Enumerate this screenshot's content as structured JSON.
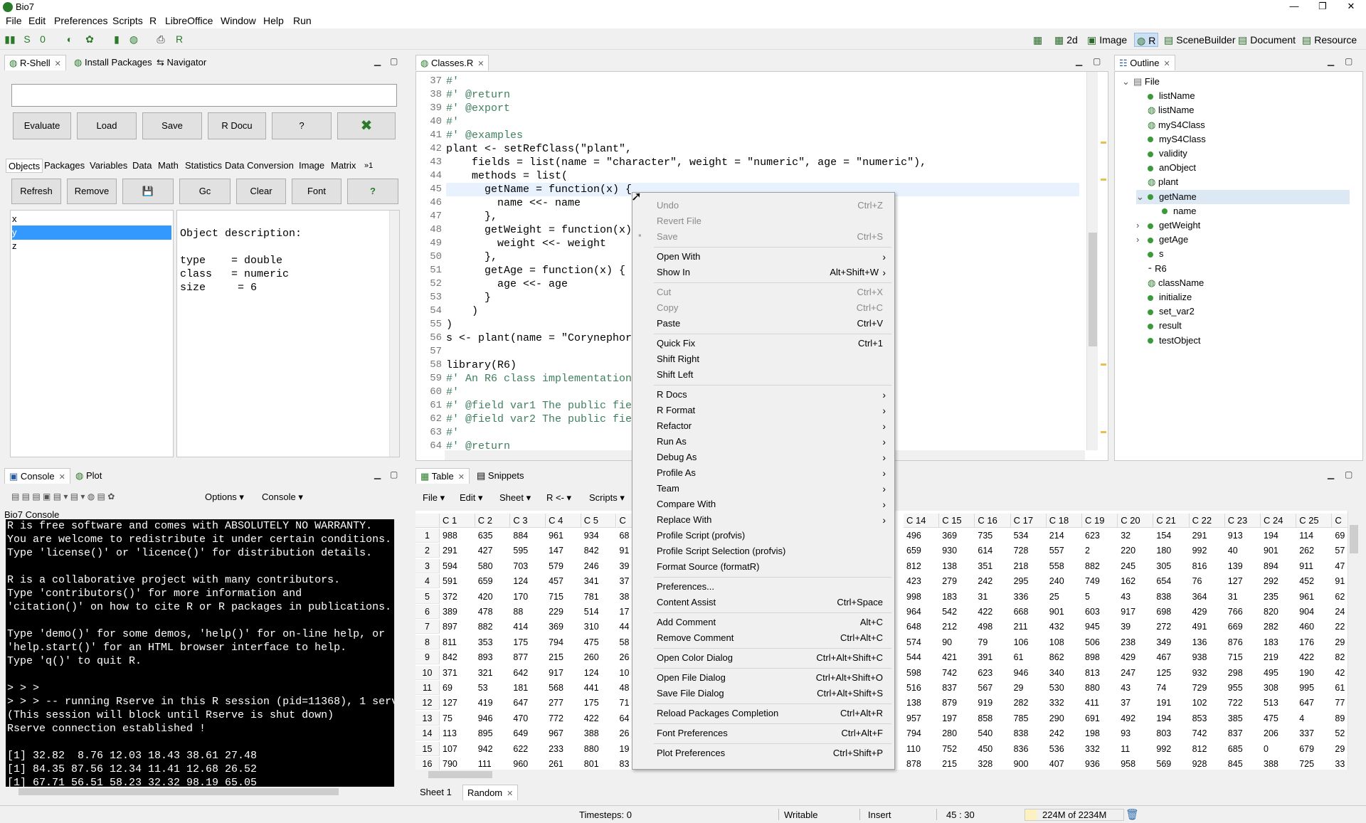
{
  "window": {
    "title": "Bio7",
    "minimize": "—",
    "restore": "❐",
    "close": "✕"
  },
  "menu": [
    "File",
    "Edit",
    "Preferences",
    "Scripts",
    "R",
    "LibreOffice",
    "Window",
    "Help",
    "Run"
  ],
  "perspectives": [
    {
      "label": "2d"
    },
    {
      "label": "Image"
    },
    {
      "label": "R"
    },
    {
      "label": "SceneBuilder"
    },
    {
      "label": "Document"
    },
    {
      "label": "Resource"
    }
  ],
  "rshell": {
    "tabs": [
      "R-Shell",
      "Install Packages",
      "Navigator"
    ],
    "input_value": "",
    "buttons": [
      "Evaluate",
      "Load",
      "Save",
      "R Docu",
      "?",
      "✖"
    ],
    "subtabs": [
      "Objects",
      "Packages",
      "Variables",
      "Data",
      "Math",
      "Statistics",
      "Data Conversion",
      "Image",
      "Matrix",
      "»1"
    ],
    "tools": [
      "Refresh",
      "Remove",
      "💾",
      "Gc",
      "Clear",
      "Font",
      "?"
    ],
    "objects": [
      "x",
      "y",
      "z"
    ],
    "selected_object": "y",
    "description": [
      "Object description:",
      "",
      "type    = double",
      "class   = numeric",
      "size     = 6"
    ]
  },
  "editor": {
    "tab": "Classes.R",
    "lines": [
      {
        "n": "37",
        "t": "#'"
      },
      {
        "n": "38",
        "t": "#' @return"
      },
      {
        "n": "39",
        "t": "#' @export"
      },
      {
        "n": "40",
        "t": "#'"
      },
      {
        "n": "41",
        "t": "#' @examples"
      },
      {
        "n": "42",
        "t": "plant <- setRefClass(\"plant\","
      },
      {
        "n": "43",
        "t": "    fields = list(name = \"character\", weight = \"numeric\", age = \"numeric\"),"
      },
      {
        "n": "44",
        "t": "    methods = list("
      },
      {
        "n": "45",
        "t": "      getName = function(x) {"
      },
      {
        "n": "46",
        "t": "        name <<- name"
      },
      {
        "n": "47",
        "t": "      },"
      },
      {
        "n": "48",
        "t": "      getWeight = function(x)"
      },
      {
        "n": "49",
        "t": "        weight <<- weight"
      },
      {
        "n": "50",
        "t": "      },"
      },
      {
        "n": "51",
        "t": "      getAge = function(x) {"
      },
      {
        "n": "52",
        "t": "        age <<- age"
      },
      {
        "n": "53",
        "t": "      }"
      },
      {
        "n": "54",
        "t": "    )"
      },
      {
        "n": "55",
        "t": ")"
      },
      {
        "n": "56",
        "t": "s <- plant(name = \"Corynephor"
      },
      {
        "n": "57",
        "t": ""
      },
      {
        "n": "58",
        "t": "library(R6)"
      },
      {
        "n": "59",
        "t": "#' An R6 class implementation"
      },
      {
        "n": "60",
        "t": "#'"
      },
      {
        "n": "61",
        "t": "#' @field var1 The public fie"
      },
      {
        "n": "62",
        "t": "#' @field var2 The public fie"
      },
      {
        "n": "63",
        "t": "#'"
      },
      {
        "n": "64",
        "t": "#' @return"
      }
    ]
  },
  "outline": {
    "tab": "Outline",
    "items": [
      {
        "label": "File",
        "level": 0,
        "kind": "file",
        "expander": "⌄"
      },
      {
        "label": "listName",
        "level": 1,
        "kind": "dot",
        "expander": ""
      },
      {
        "label": "listName",
        "level": 1,
        "kind": "r",
        "expander": ""
      },
      {
        "label": "myS4Class",
        "level": 1,
        "kind": "r",
        "expander": ""
      },
      {
        "label": "myS4Class",
        "level": 1,
        "kind": "dot",
        "expander": ""
      },
      {
        "label": "validity",
        "level": 1,
        "kind": "dot",
        "expander": ""
      },
      {
        "label": "anObject",
        "level": 1,
        "kind": "dot",
        "expander": ""
      },
      {
        "label": "plant",
        "level": 1,
        "kind": "r",
        "expander": ""
      },
      {
        "label": "getName",
        "level": 1,
        "kind": "dot",
        "expander": "⌄"
      },
      {
        "label": "name",
        "level": 2,
        "kind": "dot",
        "expander": ""
      },
      {
        "label": "getWeight",
        "level": 1,
        "kind": "dot",
        "expander": "›"
      },
      {
        "label": "getAge",
        "level": 1,
        "kind": "dot",
        "expander": "›"
      },
      {
        "label": "s",
        "level": 1,
        "kind": "dot",
        "expander": ""
      },
      {
        "label": "R6",
        "level": 1,
        "kind": "lib",
        "expander": ""
      },
      {
        "label": "className",
        "level": 1,
        "kind": "r",
        "expander": ""
      },
      {
        "label": "initialize",
        "level": 1,
        "kind": "dot",
        "expander": ""
      },
      {
        "label": "set_var2",
        "level": 1,
        "kind": "dot",
        "expander": ""
      },
      {
        "label": "result",
        "level": 1,
        "kind": "dot",
        "expander": ""
      },
      {
        "label": "testObject",
        "level": 1,
        "kind": "dot",
        "expander": ""
      }
    ]
  },
  "context_menu": [
    {
      "label": "Undo",
      "shortcut": "Ctrl+Z",
      "disabled": true
    },
    {
      "label": "Revert File",
      "shortcut": "",
      "disabled": true
    },
    {
      "label": "Save",
      "shortcut": "Ctrl+S",
      "disabled": true
    },
    {
      "sep": true
    },
    {
      "label": "Open With",
      "submenu": true
    },
    {
      "label": "Show In",
      "shortcut": "Alt+Shift+W",
      "submenu": true
    },
    {
      "sep": true
    },
    {
      "label": "Cut",
      "shortcut": "Ctrl+X",
      "disabled": true
    },
    {
      "label": "Copy",
      "shortcut": "Ctrl+C",
      "disabled": true
    },
    {
      "label": "Paste",
      "shortcut": "Ctrl+V"
    },
    {
      "sep": true
    },
    {
      "label": "Quick Fix",
      "shortcut": "Ctrl+1"
    },
    {
      "label": "Shift Right"
    },
    {
      "label": "Shift Left"
    },
    {
      "sep": true
    },
    {
      "label": "R Docs",
      "submenu": true
    },
    {
      "label": "R Format",
      "submenu": true
    },
    {
      "label": "Refactor",
      "submenu": true
    },
    {
      "label": "Run As",
      "submenu": true
    },
    {
      "label": "Debug As",
      "submenu": true
    },
    {
      "label": "Profile As",
      "submenu": true
    },
    {
      "label": "Team",
      "submenu": true
    },
    {
      "label": "Compare With",
      "submenu": true
    },
    {
      "label": "Replace With",
      "submenu": true
    },
    {
      "label": "Profile Script (profvis)"
    },
    {
      "label": "Profile Script Selection (profvis)"
    },
    {
      "label": "Format Source (formatR)"
    },
    {
      "sep": true
    },
    {
      "label": "Preferences..."
    },
    {
      "label": "Content Assist",
      "shortcut": "Ctrl+Space"
    },
    {
      "sep": true
    },
    {
      "label": "Add Comment",
      "shortcut": "Alt+C"
    },
    {
      "label": "Remove Comment",
      "shortcut": "Ctrl+Alt+C"
    },
    {
      "sep": true
    },
    {
      "label": "Open Color Dialog",
      "shortcut": "Ctrl+Alt+Shift+C"
    },
    {
      "sep": true
    },
    {
      "label": "Open File Dialog",
      "shortcut": "Ctrl+Alt+Shift+O"
    },
    {
      "label": "Save File Dialog",
      "shortcut": "Ctrl+Alt+Shift+S"
    },
    {
      "sep": true
    },
    {
      "label": "Reload Packages Completion",
      "shortcut": "Ctrl+Alt+R"
    },
    {
      "sep": true
    },
    {
      "label": "Font Preferences",
      "shortcut": "Ctrl+Alt+F"
    },
    {
      "sep": true
    },
    {
      "label": "Plot Preferences",
      "shortcut": "Ctrl+Shift+P"
    }
  ],
  "console": {
    "tabs": [
      "Console",
      "Plot"
    ],
    "toolbar": {
      "options": "Options",
      "console": "Console"
    },
    "name": "Bio7 Console",
    "lines": [
      "R is free software and comes with ABSOLUTELY NO WARRANTY.",
      "You are welcome to redistribute it under certain conditions.",
      "Type 'license()' or 'licence()' for distribution details.",
      "",
      "R is a collaborative project with many contributors.",
      "Type 'contributors()' for more information and",
      "'citation()' on how to cite R or R packages in publications.",
      "",
      "Type 'demo()' for some demos, 'help()' for on-line help, or",
      "'help.start()' for an HTML browser interface to help.",
      "Type 'q()' to quit R.",
      "",
      "> > >",
      "> > > -- running Rserve in this R session (pid=11368), 1 serv",
      "(This session will block until Rserve is shut down)",
      "Rserve connection established !",
      "",
      "[1] 32.82  8.76 12.03 18.43 38.61 27.48",
      "[1] 84.35 87.56 12.34 11.41 12.68 26.52",
      "[1] 67.71 56.51 58.23 32.32 98.19 65.05"
    ]
  },
  "table": {
    "tabs": [
      "Table",
      "Snippets"
    ],
    "menu": [
      "File",
      "Edit",
      "Sheet",
      "R <-",
      "Scripts"
    ],
    "sheets": [
      "Sheet 1",
      "Random"
    ],
    "left_headers": [
      "C 1",
      "C 2",
      "C 3",
      "C 4",
      "C 5",
      "C"
    ],
    "right_headers": [
      "C 14",
      "C 15",
      "C 16",
      "C 17",
      "C 18",
      "C 19",
      "C 20",
      "C 21",
      "C 22",
      "C 23",
      "C 24",
      "C 25",
      "C"
    ],
    "left_rows": [
      [
        "988",
        "635",
        "884",
        "961",
        "934",
        "68"
      ],
      [
        "291",
        "427",
        "595",
        "147",
        "842",
        "91"
      ],
      [
        "594",
        "580",
        "703",
        "579",
        "246",
        "39"
      ],
      [
        "591",
        "659",
        "124",
        "457",
        "341",
        "37"
      ],
      [
        "372",
        "420",
        "170",
        "715",
        "781",
        "38"
      ],
      [
        "389",
        "478",
        "88",
        "229",
        "514",
        "17"
      ],
      [
        "897",
        "882",
        "414",
        "369",
        "310",
        "44"
      ],
      [
        "811",
        "353",
        "175",
        "794",
        "475",
        "58"
      ],
      [
        "842",
        "893",
        "877",
        "215",
        "260",
        "26"
      ],
      [
        "371",
        "321",
        "642",
        "917",
        "124",
        "10"
      ],
      [
        "69",
        "53",
        "181",
        "568",
        "441",
        "48"
      ],
      [
        "127",
        "419",
        "647",
        "277",
        "175",
        "71"
      ],
      [
        "75",
        "946",
        "470",
        "772",
        "422",
        "64"
      ],
      [
        "113",
        "895",
        "649",
        "967",
        "388",
        "26"
      ],
      [
        "107",
        "942",
        "622",
        "233",
        "880",
        "19"
      ],
      [
        "790",
        "111",
        "960",
        "261",
        "801",
        "83"
      ]
    ],
    "right_rows": [
      [
        "496",
        "369",
        "735",
        "534",
        "214",
        "623",
        "32",
        "154",
        "291",
        "913",
        "194",
        "114",
        "69"
      ],
      [
        "659",
        "930",
        "614",
        "728",
        "557",
        "2",
        "220",
        "180",
        "992",
        "40",
        "901",
        "262",
        "57"
      ],
      [
        "812",
        "138",
        "351",
        "218",
        "558",
        "882",
        "245",
        "305",
        "816",
        "139",
        "894",
        "911",
        "47"
      ],
      [
        "423",
        "279",
        "242",
        "295",
        "240",
        "749",
        "162",
        "654",
        "76",
        "127",
        "292",
        "452",
        "91"
      ],
      [
        "998",
        "183",
        "31",
        "336",
        "25",
        "5",
        "43",
        "838",
        "364",
        "31",
        "235",
        "961",
        "62"
      ],
      [
        "964",
        "542",
        "422",
        "668",
        "901",
        "603",
        "917",
        "698",
        "429",
        "766",
        "820",
        "904",
        "24"
      ],
      [
        "648",
        "212",
        "498",
        "211",
        "432",
        "945",
        "39",
        "272",
        "491",
        "669",
        "282",
        "460",
        "22"
      ],
      [
        "574",
        "90",
        "79",
        "106",
        "108",
        "506",
        "238",
        "349",
        "136",
        "876",
        "183",
        "176",
        "29"
      ],
      [
        "544",
        "421",
        "391",
        "61",
        "862",
        "898",
        "429",
        "467",
        "938",
        "715",
        "219",
        "422",
        "82"
      ],
      [
        "598",
        "742",
        "623",
        "946",
        "340",
        "813",
        "247",
        "125",
        "932",
        "298",
        "495",
        "190",
        "42"
      ],
      [
        "516",
        "837",
        "567",
        "29",
        "530",
        "880",
        "43",
        "74",
        "729",
        "955",
        "308",
        "995",
        "61"
      ],
      [
        "138",
        "879",
        "919",
        "282",
        "332",
        "411",
        "37",
        "191",
        "102",
        "722",
        "513",
        "647",
        "77"
      ],
      [
        "957",
        "197",
        "858",
        "785",
        "290",
        "691",
        "492",
        "194",
        "853",
        "385",
        "475",
        "4",
        "89"
      ],
      [
        "794",
        "280",
        "540",
        "838",
        "242",
        "198",
        "93",
        "803",
        "742",
        "837",
        "206",
        "337",
        "52"
      ],
      [
        "110",
        "752",
        "450",
        "836",
        "536",
        "332",
        "11",
        "992",
        "812",
        "685",
        "0",
        "679",
        "29"
      ],
      [
        "878",
        "215",
        "328",
        "900",
        "407",
        "936",
        "958",
        "569",
        "928",
        "845",
        "388",
        "725",
        "33"
      ]
    ],
    "row_numbers": [
      "1",
      "2",
      "3",
      "4",
      "5",
      "6",
      "7",
      "8",
      "9",
      "10",
      "11",
      "12",
      "13",
      "14",
      "15",
      "16"
    ]
  },
  "status": {
    "timesteps": "Timesteps: 0",
    "mode": "Writable",
    "insert": "Insert",
    "position": "45 : 30",
    "memory": "224M of 2234M"
  },
  "colors": {
    "accent_select": "#3399ff",
    "r_green": "#2a7a2a",
    "comment": "#3f7f5f",
    "keyword": "#7f0055",
    "string": "#2a00ff"
  }
}
